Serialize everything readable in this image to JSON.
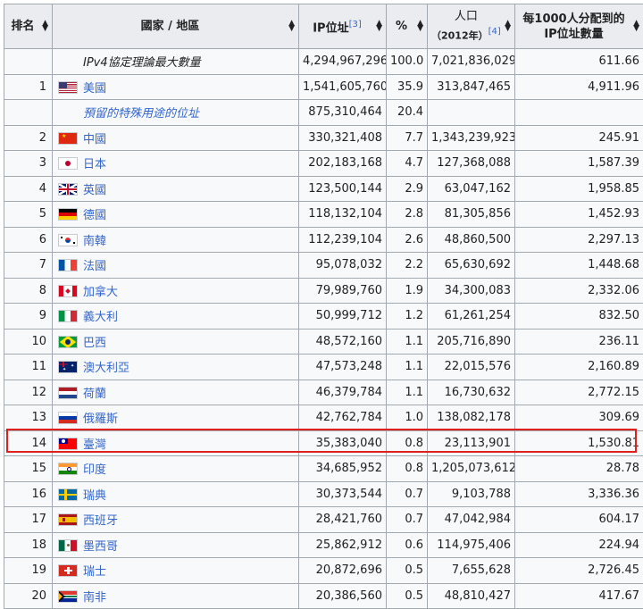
{
  "headers": {
    "rank": "排名",
    "country": "國家 / 地區",
    "ip": "IP位址",
    "ip_ref": "[3]",
    "pct": "%",
    "pop": "人口",
    "pop_year": "（2012年）",
    "pop_ref": "[4]",
    "per_line1": "每1000人分配到的",
    "per_line2": "IP位址數量"
  },
  "rows": [
    {
      "rank": "",
      "country": "IPv4協定理論最大數量",
      "flag": "",
      "style": "italic",
      "ip": "4,294,967,296",
      "pct": "100.0",
      "pop": "7,021,836,029",
      "per": "611.66"
    },
    {
      "rank": "1",
      "country": "美國",
      "flag": "us",
      "style": "link",
      "ip": "1,541,605,760",
      "pct": "35.9",
      "pop": "313,847,465",
      "per": "4,911.96"
    },
    {
      "rank": "",
      "country": "預留的特殊用途的位址",
      "flag": "",
      "style": "italic-link",
      "ip": "875,310,464",
      "pct": "20.4",
      "pop": "",
      "per": ""
    },
    {
      "rank": "2",
      "country": "中國",
      "flag": "cn",
      "style": "link",
      "ip": "330,321,408",
      "pct": "7.7",
      "pop": "1,343,239,923",
      "per": "245.91"
    },
    {
      "rank": "3",
      "country": "日本",
      "flag": "jp",
      "style": "link",
      "ip": "202,183,168",
      "pct": "4.7",
      "pop": "127,368,088",
      "per": "1,587.39"
    },
    {
      "rank": "4",
      "country": "英國",
      "flag": "gb",
      "style": "link",
      "ip": "123,500,144",
      "pct": "2.9",
      "pop": "63,047,162",
      "per": "1,958.85"
    },
    {
      "rank": "5",
      "country": "德國",
      "flag": "de",
      "style": "link",
      "ip": "118,132,104",
      "pct": "2.8",
      "pop": "81,305,856",
      "per": "1,452.93"
    },
    {
      "rank": "6",
      "country": "南韓",
      "flag": "kr",
      "style": "link",
      "ip": "112,239,104",
      "pct": "2.6",
      "pop": "48,860,500",
      "per": "2,297.13"
    },
    {
      "rank": "7",
      "country": "法國",
      "flag": "fr",
      "style": "link",
      "ip": "95,078,032",
      "pct": "2.2",
      "pop": "65,630,692",
      "per": "1,448.68"
    },
    {
      "rank": "8",
      "country": "加拿大",
      "flag": "ca",
      "style": "link",
      "ip": "79,989,760",
      "pct": "1.9",
      "pop": "34,300,083",
      "per": "2,332.06"
    },
    {
      "rank": "9",
      "country": "義大利",
      "flag": "it",
      "style": "link",
      "ip": "50,999,712",
      "pct": "1.2",
      "pop": "61,261,254",
      "per": "832.50"
    },
    {
      "rank": "10",
      "country": "巴西",
      "flag": "br",
      "style": "link",
      "ip": "48,572,160",
      "pct": "1.1",
      "pop": "205,716,890",
      "per": "236.11"
    },
    {
      "rank": "11",
      "country": "澳大利亞",
      "flag": "au",
      "style": "link",
      "ip": "47,573,248",
      "pct": "1.1",
      "pop": "22,015,576",
      "per": "2,160.89"
    },
    {
      "rank": "12",
      "country": "荷蘭",
      "flag": "nl",
      "style": "link",
      "ip": "46,379,784",
      "pct": "1.1",
      "pop": "16,730,632",
      "per": "2,772.15"
    },
    {
      "rank": "13",
      "country": "俄羅斯",
      "flag": "ru",
      "style": "link",
      "ip": "42,762,784",
      "pct": "1.0",
      "pop": "138,082,178",
      "per": "309.69"
    },
    {
      "rank": "14",
      "country": "臺灣",
      "flag": "tw",
      "style": "link",
      "ip": "35,383,040",
      "pct": "0.8",
      "pop": "23,113,901",
      "per": "1,530.81"
    },
    {
      "rank": "15",
      "country": "印度",
      "flag": "in",
      "style": "link",
      "ip": "34,685,952",
      "pct": "0.8",
      "pop": "1,205,073,612",
      "per": "28.78"
    },
    {
      "rank": "16",
      "country": "瑞典",
      "flag": "se",
      "style": "link",
      "ip": "30,373,544",
      "pct": "0.7",
      "pop": "9,103,788",
      "per": "3,336.36"
    },
    {
      "rank": "17",
      "country": "西班牙",
      "flag": "es",
      "style": "link",
      "ip": "28,421,760",
      "pct": "0.7",
      "pop": "47,042,984",
      "per": "604.17"
    },
    {
      "rank": "18",
      "country": "墨西哥",
      "flag": "mx",
      "style": "link",
      "ip": "25,862,912",
      "pct": "0.6",
      "pop": "114,975,406",
      "per": "224.94"
    },
    {
      "rank": "19",
      "country": "瑞士",
      "flag": "ch",
      "style": "link",
      "ip": "20,872,696",
      "pct": "0.5",
      "pop": "7,655,628",
      "per": "2,726.45"
    },
    {
      "rank": "20",
      "country": "南非",
      "flag": "za",
      "style": "link",
      "ip": "20,386,560",
      "pct": "0.5",
      "pop": "48,810,427",
      "per": "417.67"
    }
  ],
  "highlighted_country": "臺灣",
  "colors": {
    "link": "#3366cc",
    "header_bg": "#eaecf0",
    "cell_bg": "#f8f9fa",
    "border": "#a2a9b1",
    "highlight": "#e0201c"
  }
}
